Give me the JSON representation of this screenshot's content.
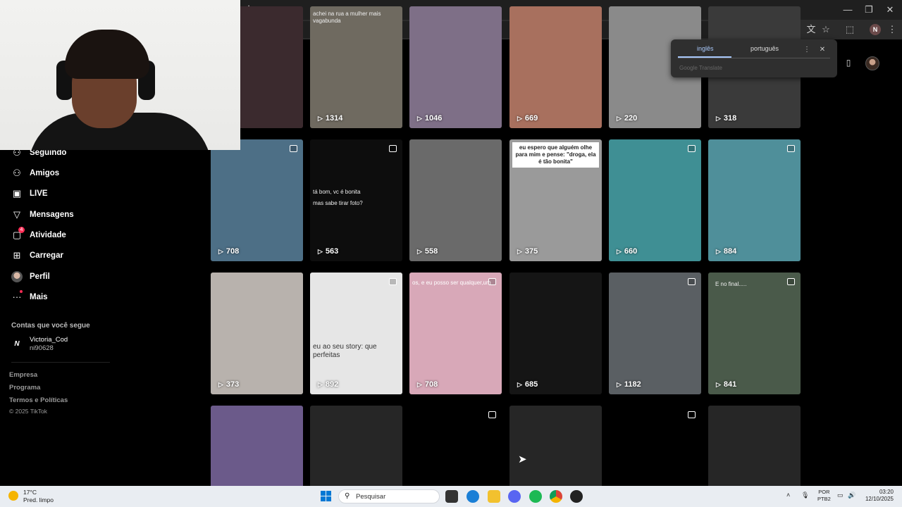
{
  "browser": {
    "new_tab_label": "+",
    "window": {
      "minimize": "—",
      "restore": "❐",
      "close": "✕"
    },
    "profile_initial": "N"
  },
  "translate_popup": {
    "source_lang": "inglês",
    "target_lang": "português",
    "footer": "Google Translate",
    "more_label": "⋮",
    "close_label": "✕"
  },
  "sidebar": {
    "items": [
      {
        "label": "Seguindo",
        "icon": "following-icon"
      },
      {
        "label": "Amigos",
        "icon": "friends-icon"
      },
      {
        "label": "LIVE",
        "icon": "live-icon"
      },
      {
        "label": "Mensagens",
        "icon": "messages-icon"
      },
      {
        "label": "Atividade",
        "icon": "activity-icon",
        "badge": "4"
      },
      {
        "label": "Carregar",
        "icon": "upload-icon"
      },
      {
        "label": "Perfil",
        "icon": "profile-avatar"
      },
      {
        "label": "Mais",
        "icon": "more-icon"
      }
    ],
    "following_title": "Contas que você segue",
    "following": [
      {
        "name": "Victoria_Cod",
        "handle": "ni90628",
        "logo": "N"
      }
    ],
    "footer_links": [
      "Empresa",
      "Programa",
      "Termos e Políticas"
    ],
    "copyright": "© 2025 TikTok"
  },
  "grid": {
    "rows": [
      [
        {
          "views": "",
          "bg": "#3b2a2e"
        },
        {
          "views": "1314",
          "bg": "#6f6a60",
          "caption": "achei na rua a mulher mais vagabunda"
        },
        {
          "views": "1046",
          "bg": "#7e6f87"
        },
        {
          "views": "669",
          "bg": "#a8705e"
        },
        {
          "views": "220",
          "bg": "#8a8a8a"
        },
        {
          "views": "318",
          "bg": "#3a3a3a"
        }
      ],
      [
        {
          "views": "708",
          "bg": "#4d6f86",
          "photo": true
        },
        {
          "views": "563",
          "bg": "#0d0d0d",
          "photo": true,
          "caption": "tá bom, vc é bonita",
          "caption2": "mas sabe tirar foto?"
        },
        {
          "views": "558",
          "bg": "#6a6a6a"
        },
        {
          "views": "375",
          "bg": "#9a9a9a",
          "caption": "eu espero que alguém olhe para mim e pense: \"droga, ela é tão bonita\""
        },
        {
          "views": "660",
          "bg": "#3f8f94",
          "photo": true
        },
        {
          "views": "884",
          "bg": "#4f8f9a",
          "photo": true
        }
      ],
      [
        {
          "views": "373",
          "bg": "#b8b2ad"
        },
        {
          "views": "892",
          "bg": "#e6e6e6",
          "photo": true,
          "caption": "eu ao seu story: que perfeitas"
        },
        {
          "views": "708",
          "bg": "#d8a8b8",
          "photo": true,
          "caption": "os, e eu posso ser qualquer,um"
        },
        {
          "views": "685",
          "bg": "#151515"
        },
        {
          "views": "1182",
          "bg": "#5a5f63",
          "photo": true
        },
        {
          "views": "841",
          "bg": "#4a5a4a",
          "photo": true,
          "caption": "E no final....."
        }
      ],
      [
        {
          "views": "",
          "bg": "#6b5a8a"
        },
        {
          "views": "",
          "bg": "#262626"
        },
        {
          "views": "",
          "bg": "#000000",
          "photo": true
        },
        {
          "views": "",
          "bg": "#262626"
        },
        {
          "views": "",
          "bg": "#000000",
          "photo": true
        },
        {
          "views": "",
          "bg": "#262626"
        }
      ]
    ]
  },
  "taskbar": {
    "weather_temp": "17°C",
    "weather_desc": "Pred. limpo",
    "search_placeholder": "Pesquisar",
    "lang": "POR",
    "layout": "PTB2",
    "time": "03:20",
    "date": "12/10/2025"
  }
}
